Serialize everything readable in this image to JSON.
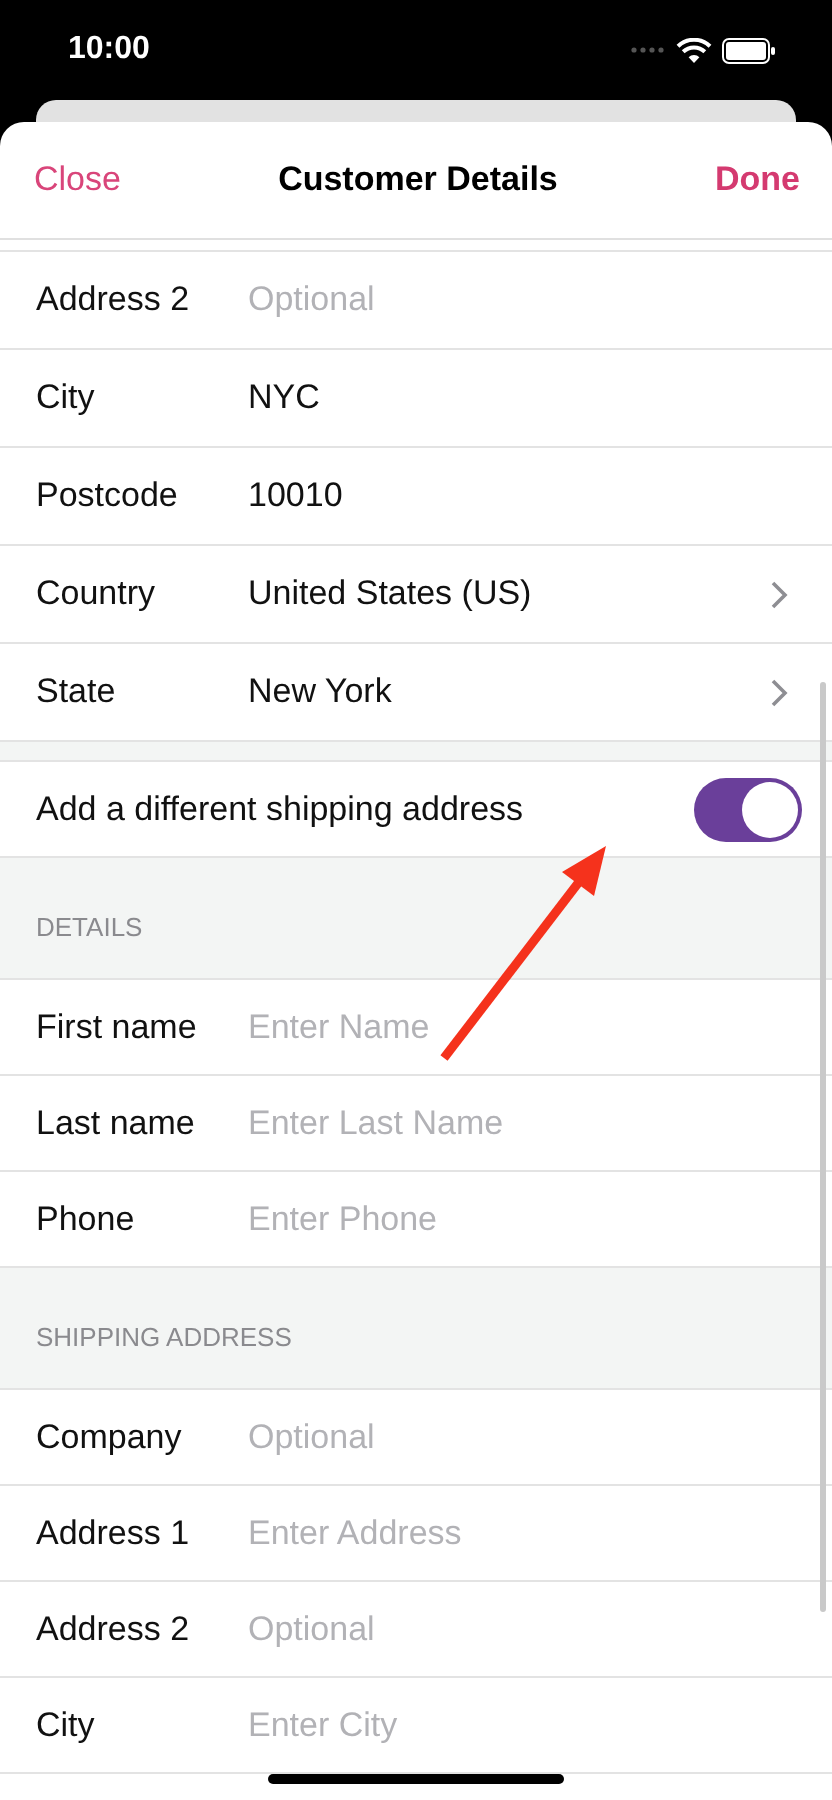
{
  "status_bar": {
    "time": "10:00"
  },
  "nav": {
    "close": "Close",
    "title": "Customer Details",
    "done": "Done"
  },
  "address_rows": [
    {
      "kind": "field",
      "label": "Address 2",
      "placeholder": "Optional"
    },
    {
      "kind": "field",
      "label": "City",
      "value": "NYC"
    },
    {
      "kind": "field",
      "label": "Postcode",
      "value": "10010"
    },
    {
      "kind": "picker",
      "label": "Country",
      "value": "United States (US)"
    },
    {
      "kind": "picker",
      "label": "State",
      "value": "New York"
    }
  ],
  "shipping_toggle": {
    "label": "Add a different shipping address",
    "on": true
  },
  "sections": [
    {
      "header": "DETAILS",
      "rows": [
        {
          "kind": "field",
          "label": "First name",
          "placeholder": "Enter Name"
        },
        {
          "kind": "field",
          "label": "Last name",
          "placeholder": "Enter Last Name"
        },
        {
          "kind": "field",
          "label": "Phone",
          "placeholder": "Enter Phone"
        }
      ]
    },
    {
      "header": "SHIPPING ADDRESS",
      "rows": [
        {
          "kind": "field",
          "label": "Company",
          "placeholder": "Optional"
        },
        {
          "kind": "field",
          "label": "Address 1",
          "placeholder": "Enter Address"
        },
        {
          "kind": "field",
          "label": "Address 2",
          "placeholder": "Optional"
        },
        {
          "kind": "field",
          "label": "City",
          "placeholder": "Enter City"
        }
      ]
    }
  ]
}
